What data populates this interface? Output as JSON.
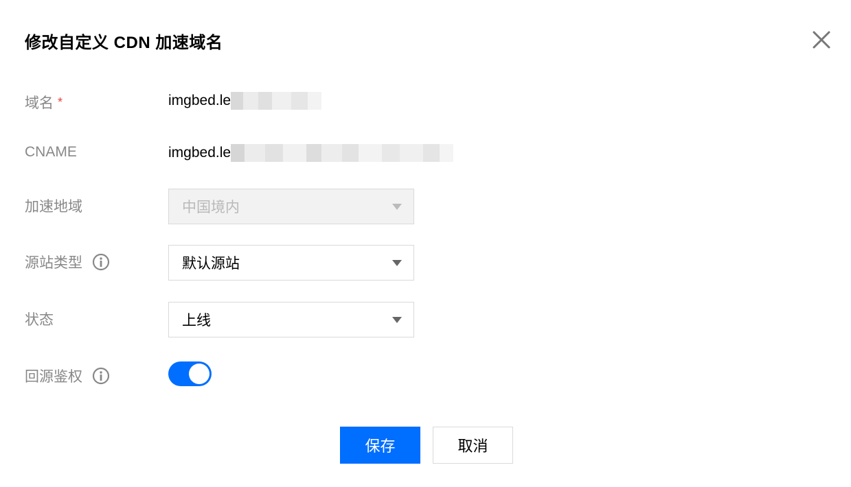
{
  "dialog": {
    "title": "修改自定义 CDN 加速域名"
  },
  "form": {
    "domain": {
      "label": "域名",
      "required_mark": "*",
      "value": "imgbed.le"
    },
    "cname": {
      "label": "CNAME",
      "value": "imgbed.le"
    },
    "region": {
      "label": "加速地域",
      "value": "中国境内",
      "disabled": true
    },
    "origin_type": {
      "label": "源站类型",
      "value": "默认源站"
    },
    "status": {
      "label": "状态",
      "value": "上线"
    },
    "origin_auth": {
      "label": "回源鉴权",
      "enabled": true
    }
  },
  "actions": {
    "save_label": "保存",
    "cancel_label": "取消"
  },
  "colors": {
    "primary": "#006eff",
    "label": "#888888",
    "required": "#e54545"
  }
}
